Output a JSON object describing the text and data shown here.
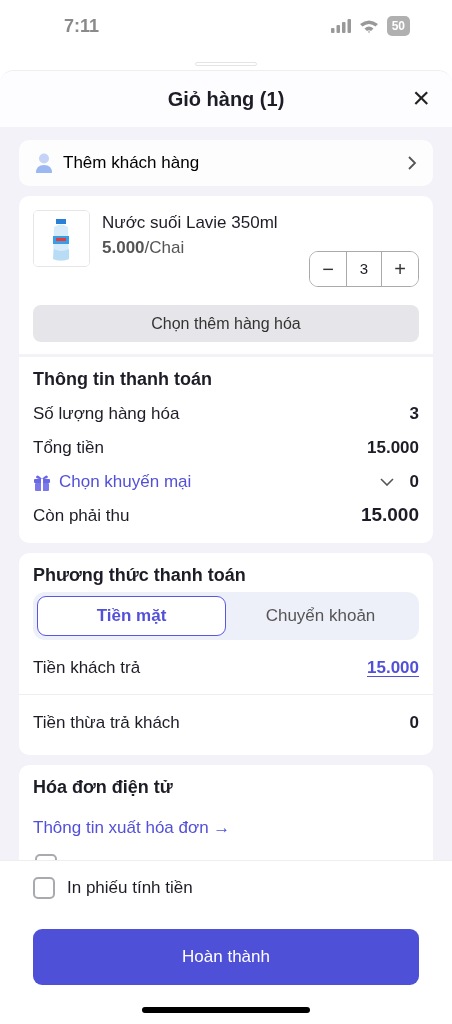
{
  "status_bar": {
    "time": "7:11",
    "battery": "50"
  },
  "header": {
    "title": "Giỏ hàng (1)",
    "close": "×"
  },
  "customer": {
    "label": "Thêm khách hàng"
  },
  "product": {
    "name": "Nước suối Lavie 350ml",
    "price": "5.000",
    "unit": "/Chai",
    "quantity": "3",
    "minus": "−",
    "plus": "+"
  },
  "add_more_button": "Chọn thêm hàng hóa",
  "payment_info": {
    "title": "Thông tin thanh toán",
    "rows": [
      {
        "kind": "plain",
        "label": "Số lượng hàng hóa",
        "value": "3"
      },
      {
        "kind": "plain",
        "label": "Tổng tiền",
        "value": "15.000"
      },
      {
        "kind": "promo",
        "label": "Chọn khuyến mại",
        "value": "0"
      },
      {
        "kind": "total",
        "label": "Còn phải thu",
        "value": "15.000"
      }
    ]
  },
  "payment_method": {
    "title": "Phương thức thanh toán",
    "tabs": [
      {
        "label": "Tiền mặt",
        "selected": true
      },
      {
        "label": "Chuyển khoản",
        "selected": false
      }
    ],
    "rows": [
      {
        "kind": "link",
        "label": "Tiền khách trả",
        "value": "15.000"
      },
      {
        "kind": "plain",
        "label": "Tiền thừa trả khách",
        "value": "0"
      }
    ]
  },
  "e_invoice": {
    "title": "Hóa đơn điện tử",
    "link": "Thông tin xuất hóa đơn →",
    "partial_checkbox": {
      "checked": false
    }
  },
  "footer": {
    "print_checkbox": {
      "label": "In phiếu tính tiền",
      "checked": false
    },
    "done_button": "Hoàn thành"
  }
}
